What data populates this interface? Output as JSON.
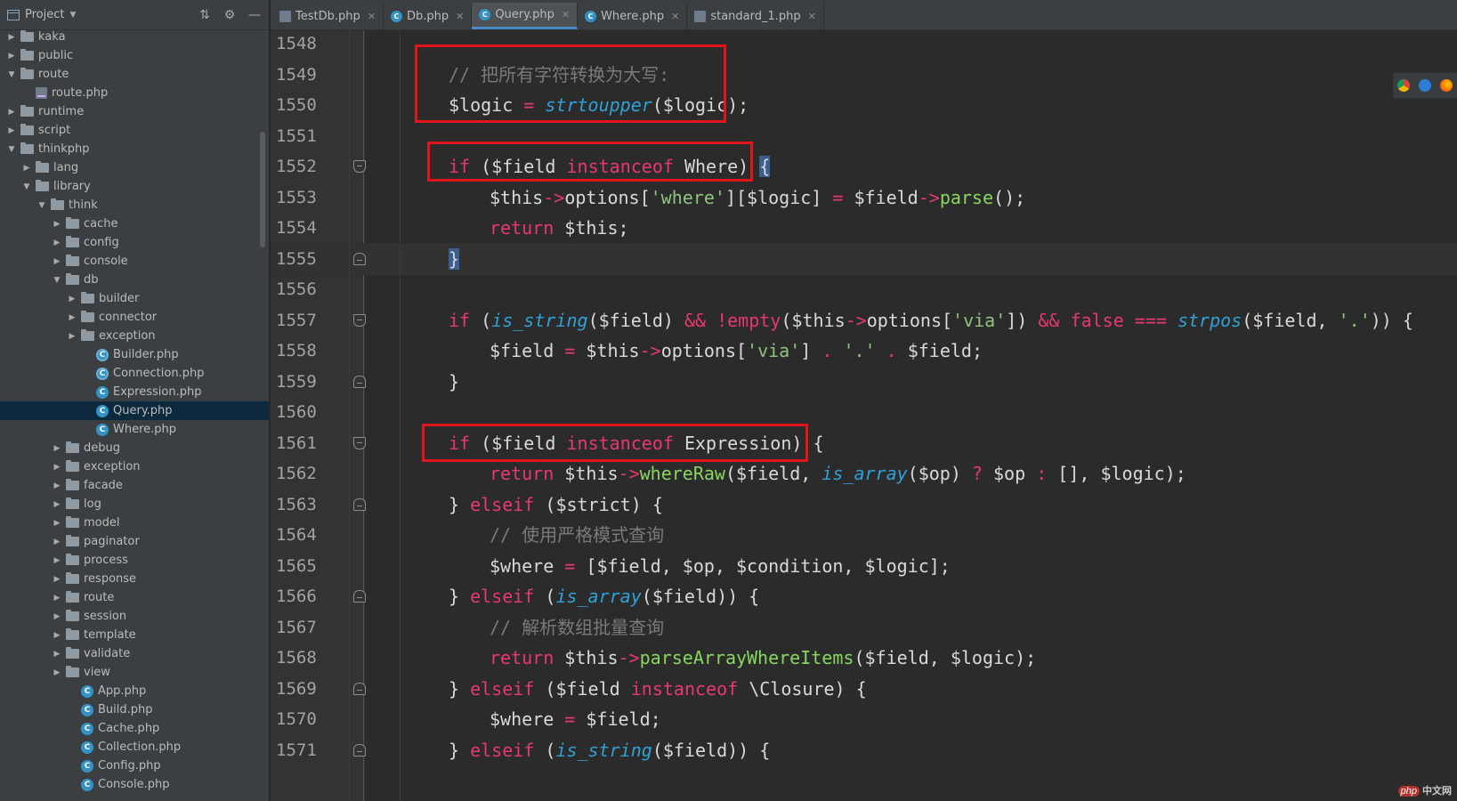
{
  "sidebar": {
    "title": "Project",
    "tree": [
      {
        "label": "kaka",
        "type": "folder",
        "depth": 1,
        "expanded": false
      },
      {
        "label": "public",
        "type": "folder",
        "depth": 1,
        "expanded": false
      },
      {
        "label": "route",
        "type": "folder",
        "depth": 1,
        "expanded": true
      },
      {
        "label": "route.php",
        "type": "php",
        "depth": 2
      },
      {
        "label": "runtime",
        "type": "folder",
        "depth": 1,
        "expanded": false
      },
      {
        "label": "script",
        "type": "folder",
        "depth": 1,
        "expanded": false
      },
      {
        "label": "thinkphp",
        "type": "folder",
        "depth": 1,
        "expanded": true
      },
      {
        "label": "lang",
        "type": "folder",
        "depth": 2,
        "expanded": false
      },
      {
        "label": "library",
        "type": "folder",
        "depth": 2,
        "expanded": true
      },
      {
        "label": "think",
        "type": "folder",
        "depth": 3,
        "expanded": true
      },
      {
        "label": "cache",
        "type": "folder",
        "depth": 4,
        "expanded": false
      },
      {
        "label": "config",
        "type": "folder",
        "depth": 4,
        "expanded": false
      },
      {
        "label": "console",
        "type": "folder",
        "depth": 4,
        "expanded": false
      },
      {
        "label": "db",
        "type": "folder",
        "depth": 4,
        "expanded": true
      },
      {
        "label": "builder",
        "type": "folder",
        "depth": 5,
        "expanded": false
      },
      {
        "label": "connector",
        "type": "folder",
        "depth": 5,
        "expanded": false
      },
      {
        "label": "exception",
        "type": "folder",
        "depth": 5,
        "expanded": false
      },
      {
        "label": "Builder.php",
        "type": "class-abstract",
        "depth": 6
      },
      {
        "label": "Connection.php",
        "type": "class-abstract",
        "depth": 6
      },
      {
        "label": "Expression.php",
        "type": "class",
        "depth": 6
      },
      {
        "label": "Query.php",
        "type": "class",
        "depth": 6,
        "selected": true
      },
      {
        "label": "Where.php",
        "type": "class",
        "depth": 6
      },
      {
        "label": "debug",
        "type": "folder",
        "depth": 4,
        "expanded": false
      },
      {
        "label": "exception",
        "type": "folder",
        "depth": 4,
        "expanded": false
      },
      {
        "label": "facade",
        "type": "folder",
        "depth": 4,
        "expanded": false
      },
      {
        "label": "log",
        "type": "folder",
        "depth": 4,
        "expanded": false
      },
      {
        "label": "model",
        "type": "folder",
        "depth": 4,
        "expanded": false
      },
      {
        "label": "paginator",
        "type": "folder",
        "depth": 4,
        "expanded": false
      },
      {
        "label": "process",
        "type": "folder",
        "depth": 4,
        "expanded": false
      },
      {
        "label": "response",
        "type": "folder",
        "depth": 4,
        "expanded": false
      },
      {
        "label": "route",
        "type": "folder",
        "depth": 4,
        "expanded": false
      },
      {
        "label": "session",
        "type": "folder",
        "depth": 4,
        "expanded": false
      },
      {
        "label": "template",
        "type": "folder",
        "depth": 4,
        "expanded": false
      },
      {
        "label": "validate",
        "type": "folder",
        "depth": 4,
        "expanded": false
      },
      {
        "label": "view",
        "type": "folder",
        "depth": 4,
        "expanded": false
      },
      {
        "label": "App.php",
        "type": "class",
        "depth": 5
      },
      {
        "label": "Build.php",
        "type": "class",
        "depth": 5
      },
      {
        "label": "Cache.php",
        "type": "class",
        "depth": 5
      },
      {
        "label": "Collection.php",
        "type": "class",
        "depth": 5
      },
      {
        "label": "Config.php",
        "type": "class",
        "depth": 5
      },
      {
        "label": "Console.php",
        "type": "class",
        "depth": 5
      }
    ]
  },
  "tabs": [
    {
      "label": "TestDb.php",
      "icon": "php-file-icon",
      "active": false
    },
    {
      "label": "Db.php",
      "icon": "class-icon",
      "active": false
    },
    {
      "label": "Query.php",
      "icon": "class-icon",
      "active": true
    },
    {
      "label": "Where.php",
      "icon": "class-icon",
      "active": false
    },
    {
      "label": "standard_1.php",
      "icon": "php-file-icon",
      "active": false
    }
  ],
  "editor": {
    "current_line": 1555,
    "lines": [
      {
        "n": 1548,
        "indent": 0,
        "tokens": []
      },
      {
        "n": 1549,
        "indent": 0,
        "tokens": [
          [
            "cmt",
            "// 把所有字符转换为大写:"
          ]
        ]
      },
      {
        "n": 1550,
        "indent": 0,
        "tokens": [
          [
            "var",
            "$logic"
          ],
          [
            "pl",
            " "
          ],
          [
            "op",
            "="
          ],
          [
            "pl",
            " "
          ],
          [
            "fn",
            "strtoupper"
          ],
          [
            "pl",
            "("
          ],
          [
            "var",
            "$logic"
          ],
          [
            "pl",
            ");"
          ]
        ]
      },
      {
        "n": 1551,
        "indent": 0,
        "tokens": []
      },
      {
        "n": 1552,
        "indent": 0,
        "fold": "open",
        "tokens": [
          [
            "kw2",
            "if"
          ],
          [
            "pl",
            " ("
          ],
          [
            "var",
            "$field"
          ],
          [
            "pl",
            " "
          ],
          [
            "kw2",
            "instanceof"
          ],
          [
            "pl",
            " Where) "
          ],
          [
            "brace",
            "{"
          ]
        ]
      },
      {
        "n": 1553,
        "indent": 1,
        "tokens": [
          [
            "var",
            "$this"
          ],
          [
            "op",
            "->"
          ],
          [
            "pl",
            "options["
          ],
          [
            "str",
            "'where'"
          ],
          [
            "pl",
            "]["
          ],
          [
            "var",
            "$logic"
          ],
          [
            "pl",
            "] "
          ],
          [
            "op",
            "="
          ],
          [
            "pl",
            " "
          ],
          [
            "var",
            "$field"
          ],
          [
            "op",
            "->"
          ],
          [
            "mcall",
            "parse"
          ],
          [
            "pl",
            "();"
          ]
        ]
      },
      {
        "n": 1554,
        "indent": 1,
        "tokens": [
          [
            "kw2",
            "return"
          ],
          [
            "pl",
            " "
          ],
          [
            "var",
            "$this"
          ],
          [
            "pl",
            ";"
          ]
        ]
      },
      {
        "n": 1555,
        "indent": 0,
        "fold": "close",
        "tokens": [
          [
            "brace",
            "}"
          ]
        ]
      },
      {
        "n": 1556,
        "indent": 0,
        "tokens": []
      },
      {
        "n": 1557,
        "indent": 0,
        "fold": "open",
        "tokens": [
          [
            "kw2",
            "if"
          ],
          [
            "pl",
            " ("
          ],
          [
            "fn",
            "is_string"
          ],
          [
            "pl",
            "("
          ],
          [
            "var",
            "$field"
          ],
          [
            "pl",
            ") "
          ],
          [
            "op",
            "&&"
          ],
          [
            "pl",
            " "
          ],
          [
            "op",
            "!"
          ],
          [
            "kw2",
            "empty"
          ],
          [
            "pl",
            "("
          ],
          [
            "var",
            "$this"
          ],
          [
            "op",
            "->"
          ],
          [
            "pl",
            "options["
          ],
          [
            "str",
            "'via'"
          ],
          [
            "pl",
            "]) "
          ],
          [
            "op",
            "&&"
          ],
          [
            "pl",
            " "
          ],
          [
            "kw2",
            "false"
          ],
          [
            "pl",
            " "
          ],
          [
            "op",
            "==="
          ],
          [
            "pl",
            " "
          ],
          [
            "fn",
            "strpos"
          ],
          [
            "pl",
            "("
          ],
          [
            "var",
            "$field"
          ],
          [
            "pl",
            ", "
          ],
          [
            "str",
            "'.'"
          ],
          [
            "pl",
            ")) {"
          ]
        ]
      },
      {
        "n": 1558,
        "indent": 1,
        "tokens": [
          [
            "var",
            "$field"
          ],
          [
            "pl",
            " "
          ],
          [
            "op",
            "="
          ],
          [
            "pl",
            " "
          ],
          [
            "var",
            "$this"
          ],
          [
            "op",
            "->"
          ],
          [
            "pl",
            "options["
          ],
          [
            "str",
            "'via'"
          ],
          [
            "pl",
            "] "
          ],
          [
            "op",
            "."
          ],
          [
            "pl",
            " "
          ],
          [
            "str",
            "'.'"
          ],
          [
            "pl",
            " "
          ],
          [
            "op",
            "."
          ],
          [
            "pl",
            " "
          ],
          [
            "var",
            "$field"
          ],
          [
            "pl",
            ";"
          ]
        ]
      },
      {
        "n": 1559,
        "indent": 0,
        "fold": "close",
        "tokens": [
          [
            "pl",
            "}"
          ]
        ]
      },
      {
        "n": 1560,
        "indent": 0,
        "tokens": []
      },
      {
        "n": 1561,
        "indent": 0,
        "fold": "open",
        "tokens": [
          [
            "kw2",
            "if"
          ],
          [
            "pl",
            " ("
          ],
          [
            "var",
            "$field"
          ],
          [
            "pl",
            " "
          ],
          [
            "kw2",
            "instanceof"
          ],
          [
            "pl",
            " Expression) {"
          ]
        ]
      },
      {
        "n": 1562,
        "indent": 1,
        "tokens": [
          [
            "kw2",
            "return"
          ],
          [
            "pl",
            " "
          ],
          [
            "var",
            "$this"
          ],
          [
            "op",
            "->"
          ],
          [
            "mcall",
            "whereRaw"
          ],
          [
            "pl",
            "("
          ],
          [
            "var",
            "$field"
          ],
          [
            "pl",
            ", "
          ],
          [
            "fn",
            "is_array"
          ],
          [
            "pl",
            "("
          ],
          [
            "var",
            "$op"
          ],
          [
            "pl",
            ") "
          ],
          [
            "op",
            "?"
          ],
          [
            "pl",
            " "
          ],
          [
            "var",
            "$op"
          ],
          [
            "pl",
            " "
          ],
          [
            "op",
            ":"
          ],
          [
            "pl",
            " [], "
          ],
          [
            "var",
            "$logic"
          ],
          [
            "pl",
            ");"
          ]
        ]
      },
      {
        "n": 1563,
        "indent": 0,
        "fold": "close",
        "tokens": [
          [
            "pl",
            "} "
          ],
          [
            "kw2",
            "elseif"
          ],
          [
            "pl",
            " ("
          ],
          [
            "var",
            "$strict"
          ],
          [
            "pl",
            ") {"
          ]
        ]
      },
      {
        "n": 1564,
        "indent": 1,
        "tokens": [
          [
            "cmt",
            "// 使用严格模式查询"
          ]
        ]
      },
      {
        "n": 1565,
        "indent": 1,
        "tokens": [
          [
            "var",
            "$where"
          ],
          [
            "pl",
            " "
          ],
          [
            "op",
            "="
          ],
          [
            "pl",
            " ["
          ],
          [
            "var",
            "$field"
          ],
          [
            "pl",
            ", "
          ],
          [
            "var",
            "$op"
          ],
          [
            "pl",
            ", "
          ],
          [
            "var",
            "$condition"
          ],
          [
            "pl",
            ", "
          ],
          [
            "var",
            "$logic"
          ],
          [
            "pl",
            "];"
          ]
        ]
      },
      {
        "n": 1566,
        "indent": 0,
        "fold": "close",
        "tokens": [
          [
            "pl",
            "} "
          ],
          [
            "kw2",
            "elseif"
          ],
          [
            "pl",
            " ("
          ],
          [
            "fn",
            "is_array"
          ],
          [
            "pl",
            "("
          ],
          [
            "var",
            "$field"
          ],
          [
            "pl",
            ")) {"
          ]
        ]
      },
      {
        "n": 1567,
        "indent": 1,
        "tokens": [
          [
            "cmt",
            "// 解析数组批量查询"
          ]
        ]
      },
      {
        "n": 1568,
        "indent": 1,
        "tokens": [
          [
            "kw2",
            "return"
          ],
          [
            "pl",
            " "
          ],
          [
            "var",
            "$this"
          ],
          [
            "op",
            "->"
          ],
          [
            "mcall",
            "parseArrayWhereItems"
          ],
          [
            "pl",
            "("
          ],
          [
            "var",
            "$field"
          ],
          [
            "pl",
            ", "
          ],
          [
            "var",
            "$logic"
          ],
          [
            "pl",
            ");"
          ]
        ]
      },
      {
        "n": 1569,
        "indent": 0,
        "fold": "close",
        "tokens": [
          [
            "pl",
            "} "
          ],
          [
            "kw2",
            "elseif"
          ],
          [
            "pl",
            " ("
          ],
          [
            "var",
            "$field"
          ],
          [
            "pl",
            " "
          ],
          [
            "kw2",
            "instanceof"
          ],
          [
            "pl",
            " \\Closure) {"
          ]
        ]
      },
      {
        "n": 1570,
        "indent": 1,
        "tokens": [
          [
            "var",
            "$where"
          ],
          [
            "pl",
            " "
          ],
          [
            "op",
            "="
          ],
          [
            "pl",
            " "
          ],
          [
            "var",
            "$field"
          ],
          [
            "pl",
            ";"
          ]
        ]
      },
      {
        "n": 1571,
        "indent": 0,
        "fold": "close",
        "tokens": [
          [
            "pl",
            "} "
          ],
          [
            "kw2",
            "elseif"
          ],
          [
            "pl",
            " ("
          ],
          [
            "fn",
            "is_string"
          ],
          [
            "pl",
            "("
          ],
          [
            "var",
            "$field"
          ],
          [
            "pl",
            ")) {"
          ]
        ]
      }
    ]
  },
  "browser_icons": [
    "chrome-icon",
    "edge-icon",
    "firefox-icon"
  ],
  "watermark": {
    "badge": "php",
    "text": "中文网"
  },
  "colors": {
    "highlight_box": "#e0141a",
    "selection": "#0d293e",
    "accent_tab": "#4a88c7"
  }
}
